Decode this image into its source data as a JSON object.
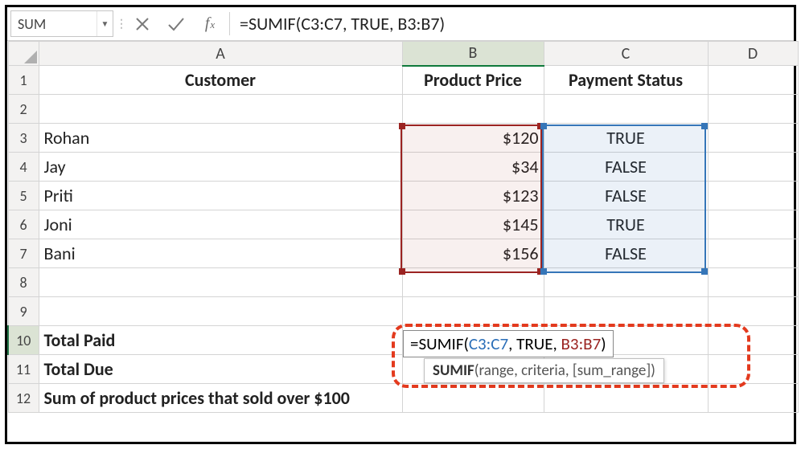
{
  "name_box": "SUM",
  "formula_bar": "=SUMIF(C3:C7, TRUE, B3:B7)",
  "columns": [
    "A",
    "B",
    "C",
    "D"
  ],
  "headers": {
    "a": "Customer",
    "b": "Product Price",
    "c": "Payment Status"
  },
  "rows": [
    {
      "n": "1"
    },
    {
      "n": "2"
    },
    {
      "n": "3",
      "a": "Rohan",
      "b": "$120",
      "c": "TRUE"
    },
    {
      "n": "4",
      "a": "Jay",
      "b": "$34",
      "c": "FALSE"
    },
    {
      "n": "5",
      "a": "Priti",
      "b": "$123",
      "c": "FALSE"
    },
    {
      "n": "6",
      "a": "Joni",
      "b": "$145",
      "c": "TRUE"
    },
    {
      "n": "7",
      "a": "Bani",
      "b": "$156",
      "c": "FALSE"
    },
    {
      "n": "8"
    },
    {
      "n": "9"
    },
    {
      "n": "10",
      "a": "Total Paid"
    },
    {
      "n": "11",
      "a": "Total Due"
    },
    {
      "n": "12",
      "a": "Sum of product prices that sold over $100"
    }
  ],
  "formula_parts": {
    "p1": "=SUMIF(",
    "p2": "C3:C7",
    "p3": ", TRUE, ",
    "p4": "B3:B7",
    "p5": ")"
  },
  "fn_tip": {
    "name": "SUMIF",
    "args": "(range, criteria, [sum_range])"
  },
  "colors": {
    "range_red": "#9B2422",
    "range_blue": "#3676B8",
    "dash": "#e33a1e"
  }
}
